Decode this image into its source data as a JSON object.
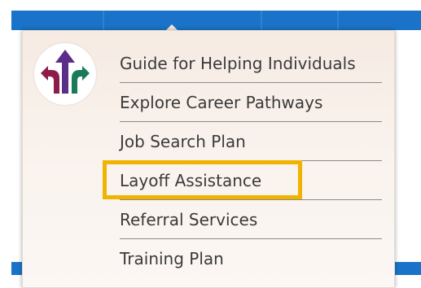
{
  "colors": {
    "nav_bar": "#1a73c8",
    "dropdown_bg": "#f6ebe3",
    "highlight_border": "#f0b400",
    "logo_purple": "#5b2d8a",
    "logo_maroon": "#8c1d4a",
    "logo_green": "#1a7a5a"
  },
  "logo": {
    "icon": "career-arrows-logo-icon"
  },
  "menu": {
    "items": [
      {
        "label": "Guide for Helping Individuals"
      },
      {
        "label": "Explore Career Pathways"
      },
      {
        "label": "Job Search Plan"
      },
      {
        "label": "Layoff Assistance",
        "highlighted": true
      },
      {
        "label": "Referral Services"
      },
      {
        "label": "Training Plan"
      }
    ]
  }
}
